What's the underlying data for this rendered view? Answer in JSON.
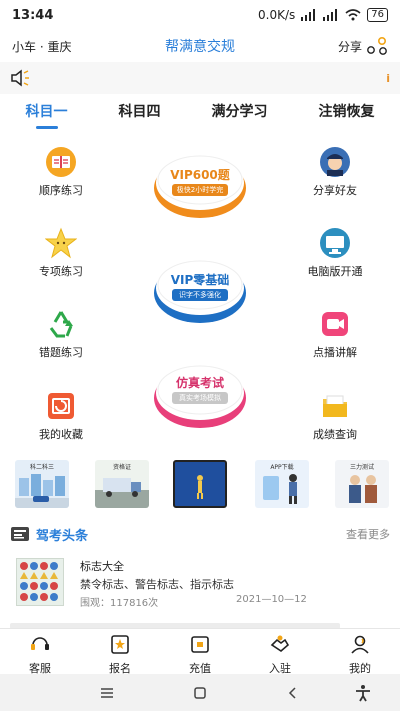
{
  "status": {
    "time": "13:44",
    "network": "0.0K/s",
    "battery": "76"
  },
  "appbar": {
    "location": "小车 · 重庆",
    "title": "帮满意交规",
    "share_label": "分享"
  },
  "tabs": [
    {
      "label": "科目一",
      "active": true
    },
    {
      "label": "科目四",
      "active": false
    },
    {
      "label": "满分学习",
      "active": false
    },
    {
      "label": "注销恢复",
      "active": false
    }
  ],
  "features": {
    "order_practice": "顺序练习",
    "special_practice": "专项练习",
    "wrong_practice": "错题练习",
    "my_favorites": "我的收藏",
    "share_friends": "分享好友",
    "pc_open": "电脑版开通",
    "video_lecture": "点播讲解",
    "score_query": "成绩查询"
  },
  "discs": {
    "vip600": {
      "title": "VIP600题",
      "subtitle": "极快2小时学完"
    },
    "vip_zero": {
      "title": "VIP零基础",
      "subtitle": "识字不多强化"
    },
    "mock": {
      "title": "仿真考试",
      "subtitle": "真实考场模拟"
    }
  },
  "banners": [
    {
      "text": "科二科三"
    },
    {
      "text": "资格证"
    },
    {
      "text": ""
    },
    {
      "text": "APP下载"
    },
    {
      "text": "三力测试"
    }
  ],
  "section": {
    "title": "驾考头条",
    "more": "查看更多"
  },
  "news": {
    "title": "标志大全",
    "description": "禁令标志、警告标志、指示标志",
    "views": "围观：117816次",
    "date": "2021—10—12"
  },
  "bottom_nav": [
    {
      "label": "客服",
      "icon": "headset-icon"
    },
    {
      "label": "报名",
      "icon": "signup-icon"
    },
    {
      "label": "充值",
      "icon": "recharge-icon"
    },
    {
      "label": "入驻",
      "icon": "handshake-icon"
    },
    {
      "label": "我的",
      "icon": "user-icon"
    }
  ]
}
